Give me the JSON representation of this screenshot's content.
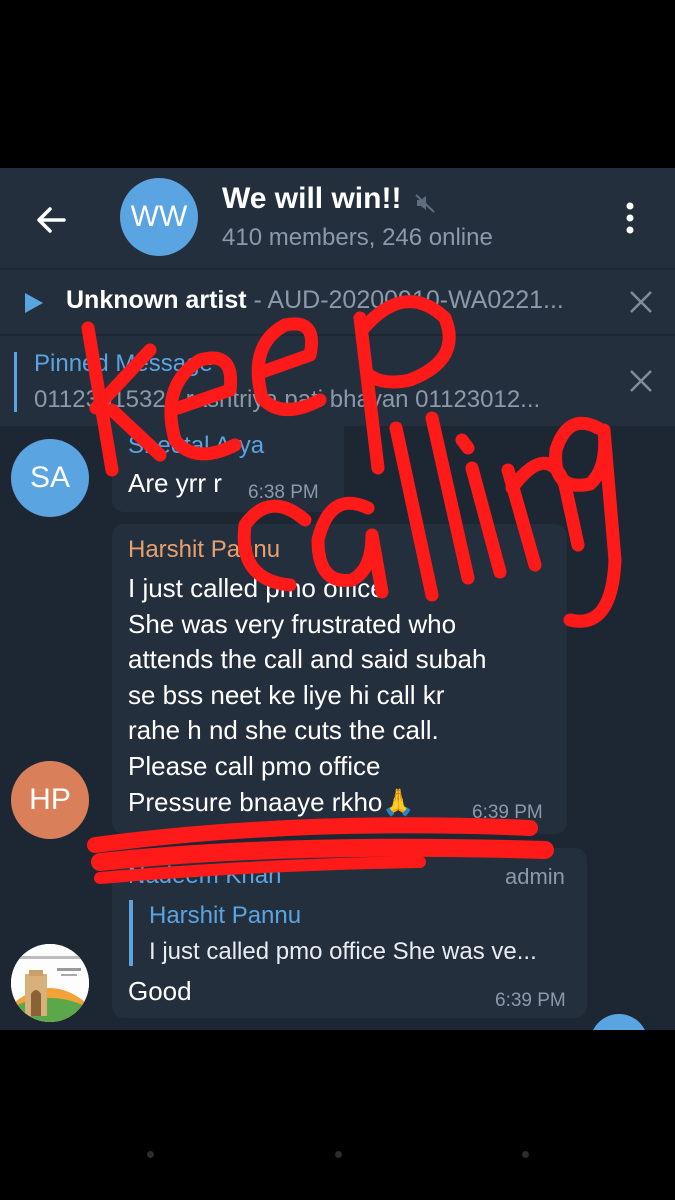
{
  "header": {
    "back_icon": "arrow-left-icon",
    "avatar_initials": "WW",
    "avatar_color": "#5ba4e2",
    "title": "We will win!!",
    "subtitle": "410 members, 246 online",
    "mute_icon": "muted-speaker-icon",
    "menu_icon": "more-vertical-icon"
  },
  "player": {
    "artist": "Unknown artist",
    "separator": " - ",
    "track": "AUD-20200910-WA0221..."
  },
  "pinned": {
    "label": "Pinned Message",
    "text": "01123015321 rashtriya pati bhavan 01123012..."
  },
  "messages": [
    {
      "avatar": "SA",
      "avatar_color": "#5ba4e2",
      "sender": "Sheetal Arya",
      "sender_color": "#5ba4e2",
      "text": "Are yrr r",
      "time": "6:38 PM"
    },
    {
      "avatar": "HP",
      "avatar_color": "#d9805a",
      "sender": "Harshit Pannu",
      "sender_color": "#e8a070",
      "text": "I just called pmo office\nShe was very frustrated who\nattends the call and said subah\nse bss neet ke liye hi call kr\nrahe h nd she cuts the call.\nPlease call pmo office\nPressure bnaaye rkho🙏",
      "time": "6:39 PM"
    },
    {
      "avatar": "india-gate-logo",
      "sender": "Nadeem Khan",
      "sender_color": "#5ba4e2",
      "badge": "admin",
      "reply_to": "Harshit Pannu",
      "reply_text": "I just called pmo office She was ve...",
      "text": "Good",
      "time": "6:39 PM"
    }
  ],
  "overlay_annotation": "keep calling",
  "overlay_color": "#ff1a1a"
}
